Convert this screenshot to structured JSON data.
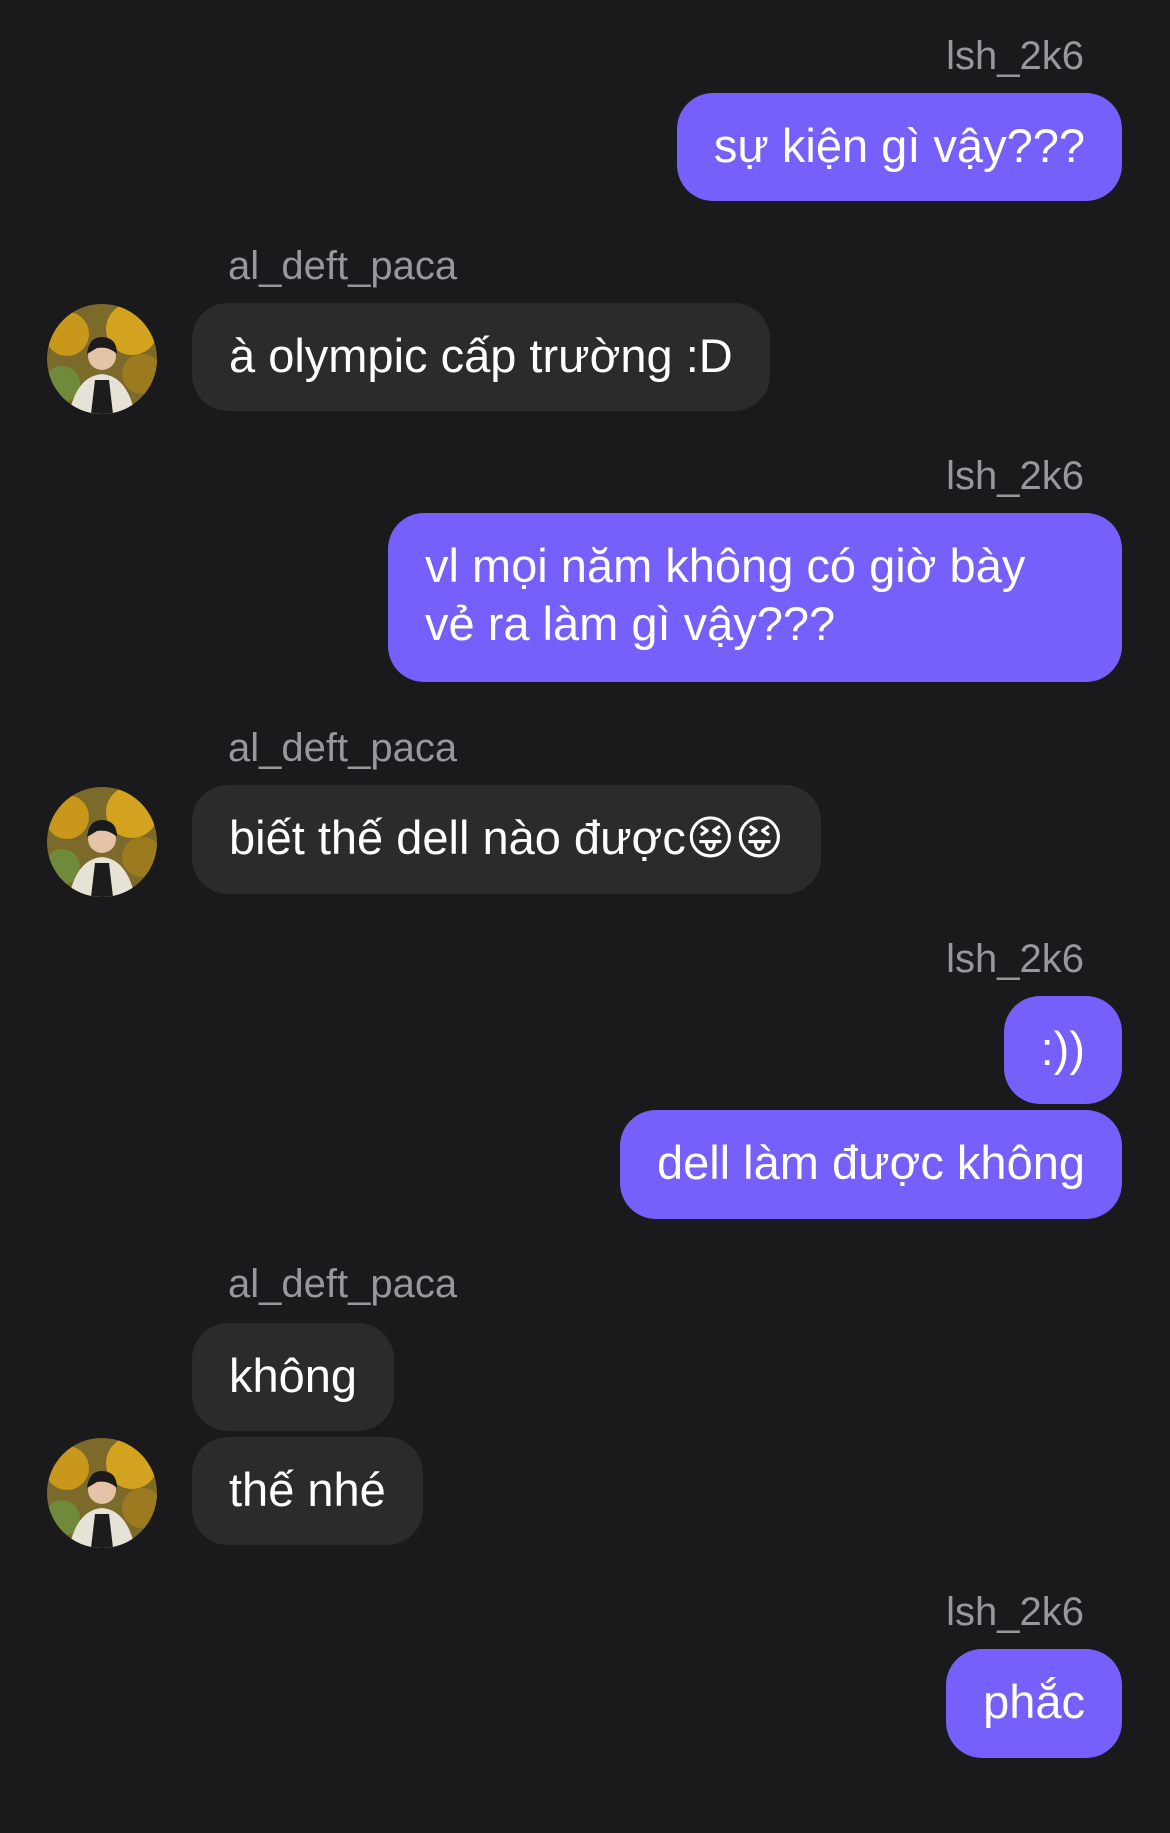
{
  "colors": {
    "background": "#1a1a1c",
    "outgoing_bubble": "#7660fb",
    "incoming_bubble": "#2b2b2e",
    "sender_name": "#98989c",
    "text": "#ffffff"
  },
  "users": {
    "me": "lsh_2k6",
    "other": "al_deft_paca"
  },
  "messages": [
    {
      "sender": "lsh_2k6",
      "text": "sự kiện gì vậy???"
    },
    {
      "sender": "al_deft_paca",
      "text": "à olympic cấp trường :D"
    },
    {
      "sender": "lsh_2k6",
      "text": "vl mọi năm không có giờ bày vẻ ra làm gì vậy???"
    },
    {
      "sender": "al_deft_paca",
      "text": "biết thế dell nào được😝😝"
    },
    {
      "sender": "lsh_2k6",
      "text": ":))"
    },
    {
      "sender": "lsh_2k6",
      "text": "dell làm được không"
    },
    {
      "sender": "al_deft_paca",
      "text": "không"
    },
    {
      "sender": "al_deft_paca",
      "text": "thế nhé"
    },
    {
      "sender": "lsh_2k6",
      "text": "phắc"
    }
  ]
}
